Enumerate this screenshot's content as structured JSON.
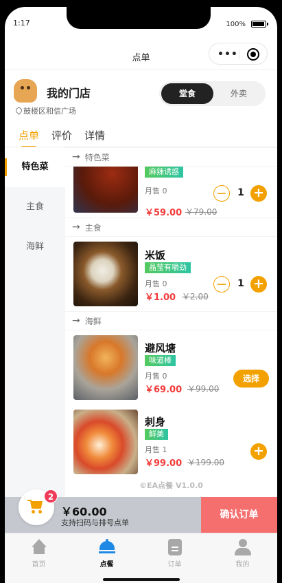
{
  "status": {
    "time": "1:17",
    "battery": "100%"
  },
  "nav": {
    "title": "点单"
  },
  "shop": {
    "name": "我的门店",
    "address": "鼓楼区和信广场"
  },
  "mode": {
    "dine_in": "堂食",
    "takeout": "外卖"
  },
  "tabs": [
    "点单",
    "评价",
    "详情"
  ],
  "categories": [
    "特色菜",
    "主食",
    "海鲜"
  ],
  "sections": {
    "special": "特色菜",
    "staple": "主食",
    "seafood": "海鲜"
  },
  "dishes": {
    "special_item": {
      "tag": "麻辣诱惑",
      "sold": "月售 0",
      "price": "￥59.00",
      "old_price": "￥79.00",
      "qty": "1"
    },
    "rice": {
      "name": "米饭",
      "tag": "晶莹有嚼劲",
      "sold": "月售 0",
      "price": "￥1.00",
      "old_price": "￥2.00",
      "qty": "1"
    },
    "shelter": {
      "name": "避风塘",
      "tag": "味道棒",
      "sold": "月售 0",
      "price": "￥69.00",
      "old_price": "￥99.00",
      "action": "选择"
    },
    "sashimi": {
      "name": "刺身",
      "tag": "鲜美",
      "sold": "月售 1",
      "price": "￥99.00",
      "old_price": "￥199.00"
    }
  },
  "footer": {
    "brand": "©EA点餐 V1.0.0"
  },
  "cart": {
    "badge": "2",
    "total": "￥60.00",
    "hint": "支持扫码与排号点单",
    "confirm": "确认订单"
  },
  "bottom_nav": [
    "首页",
    "点餐",
    "订单",
    "我的"
  ]
}
